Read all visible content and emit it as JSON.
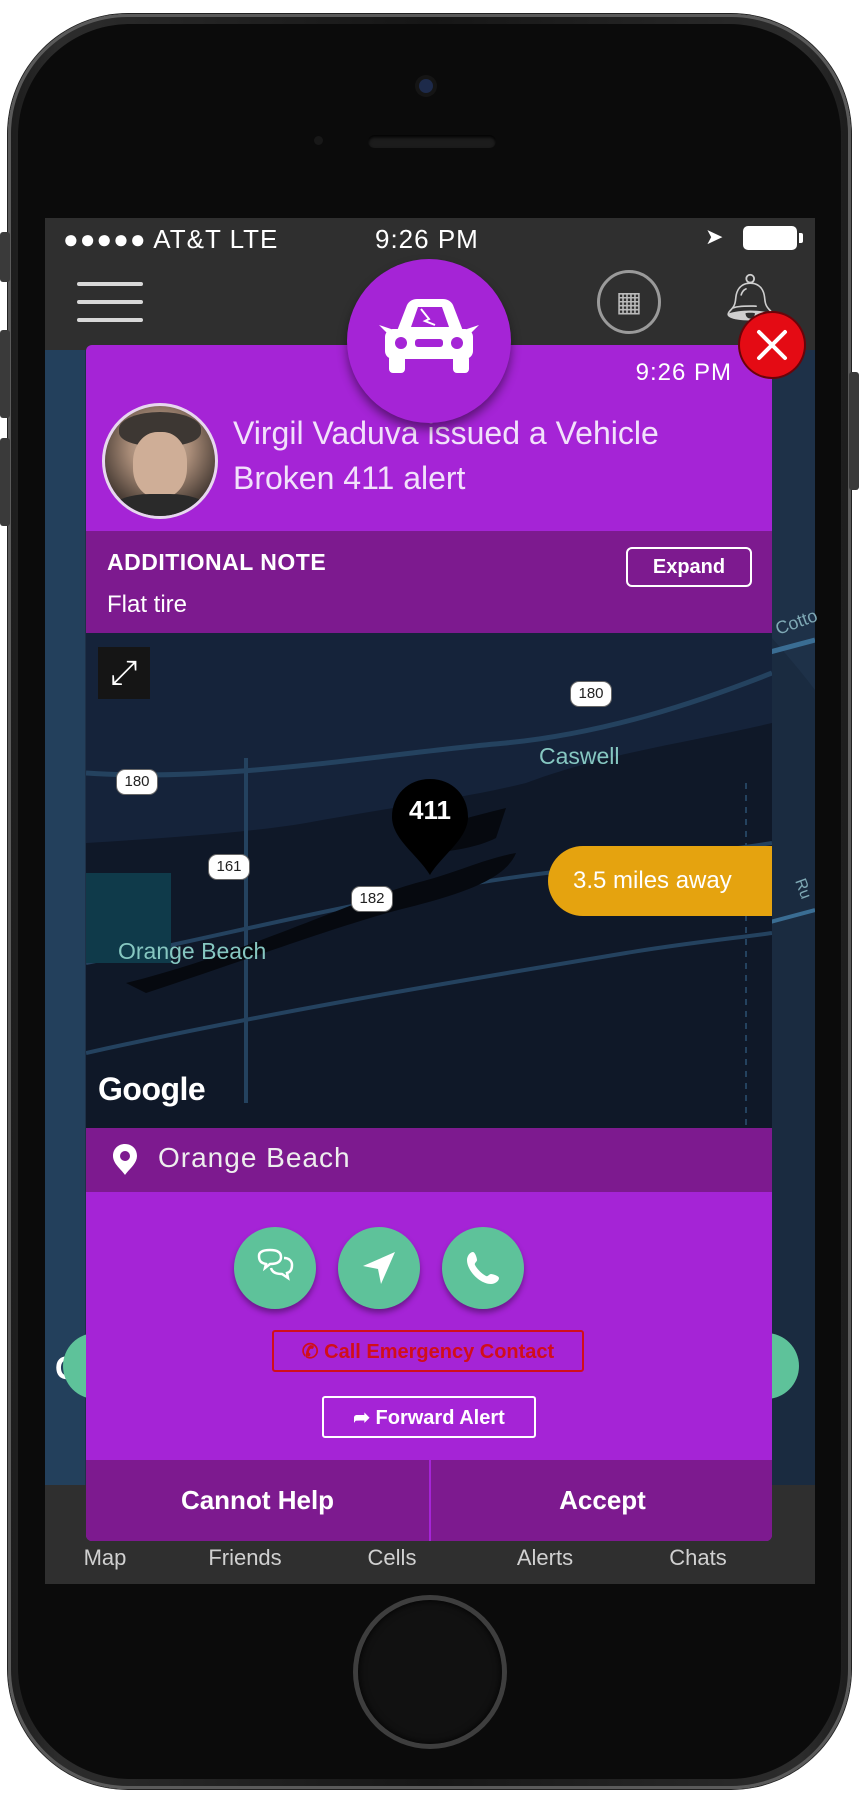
{
  "status_bar": {
    "carrier": "●●●●● AT&T  LTE",
    "time": "9:26 PM"
  },
  "tab_bar": {
    "items": [
      "Map",
      "Friends",
      "Cells",
      "Alerts",
      "Chats"
    ]
  },
  "alert": {
    "time": "9:26 PM",
    "title": "Virgil Vaduva issued a Vehicle Broken 411 alert",
    "note_label": "ADDITIONAL NOTE",
    "note_text": "Flat tire",
    "expand_label": "Expand",
    "map": {
      "road_labels": [
        "180",
        "180",
        "161",
        "182"
      ],
      "place_labels": [
        "Caswell",
        "Orange Beach",
        "Cotto",
        "Ru"
      ],
      "pin_label": "411",
      "distance": "3.5 miles away",
      "attribution": "Google",
      "bg_attribution": "G"
    },
    "location": "Orange Beach",
    "call_emergency_label": "Call Emergency Contact",
    "forward_label": "Forward Alert",
    "cannot_help_label": "Cannot Help",
    "accept_label": "Accept"
  },
  "colors": {
    "modal_purple": "#a524d6",
    "dark_purple": "#7d1a8f",
    "action_green": "#5ec29a",
    "distance_orange": "#e5a30f",
    "emergency_red": "#d10e1a"
  },
  "icons": {
    "badge": "broken-car-icon",
    "actions": [
      "chat-icon",
      "navigate-icon",
      "phone-icon"
    ],
    "close": "close-icon"
  }
}
